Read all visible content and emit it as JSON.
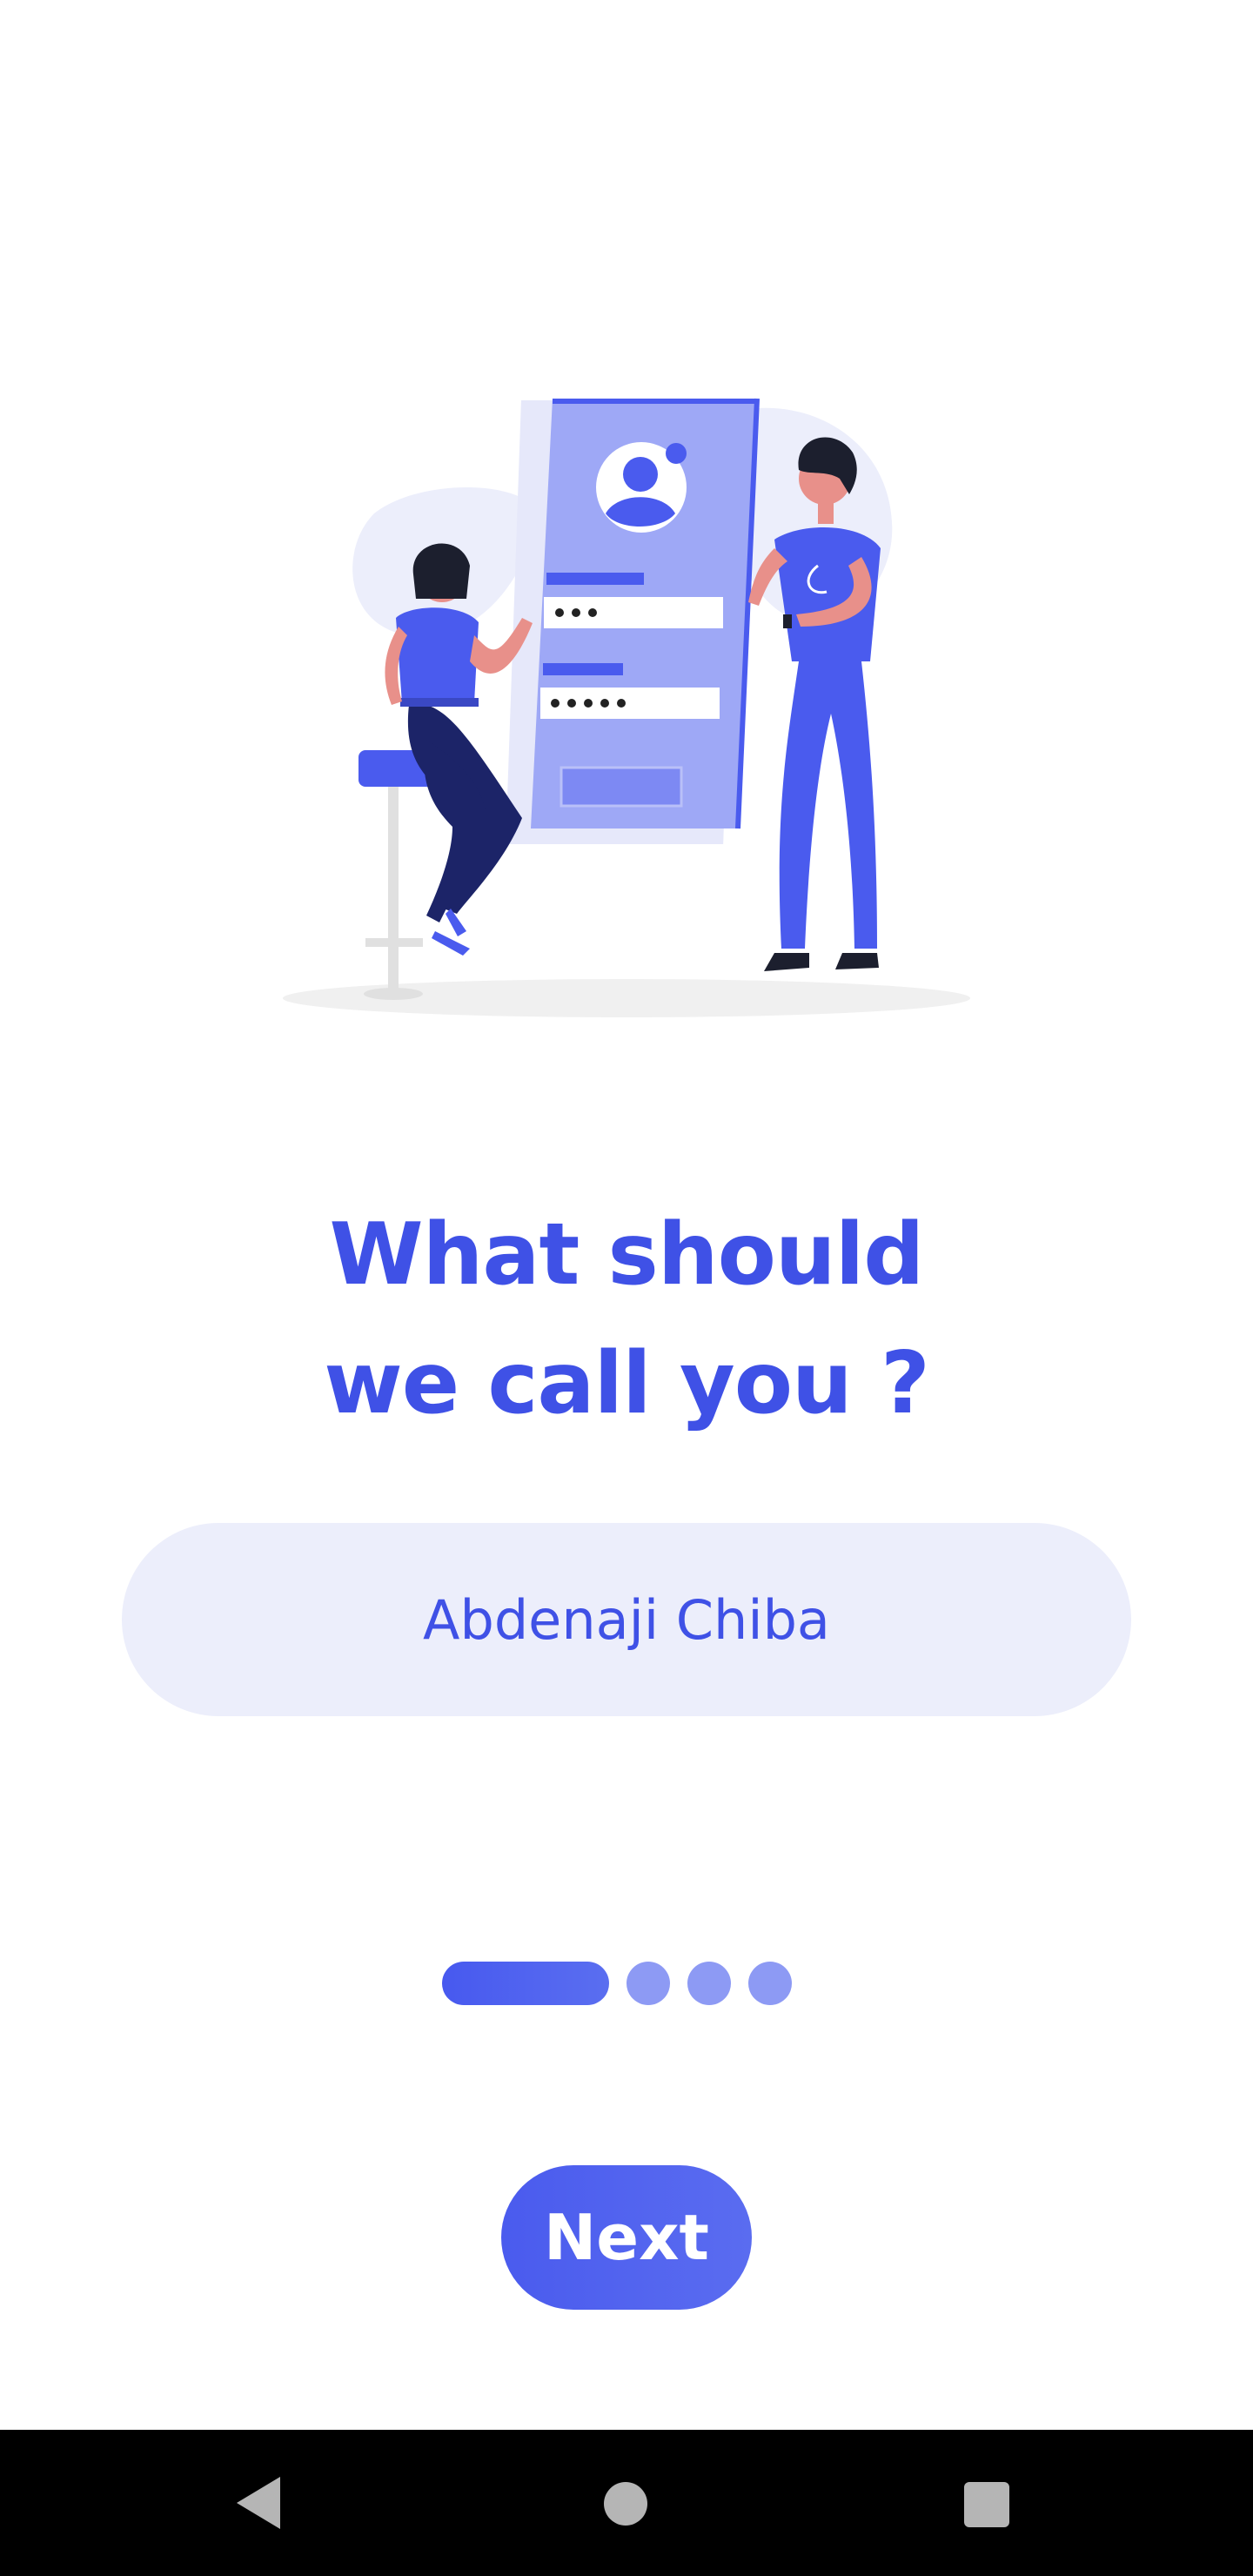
{
  "onboarding": {
    "title_line1": "What should",
    "title_line2": "we call you ?",
    "name_value": "Abdenaji Chiba",
    "next_label": "Next",
    "pager": {
      "total_steps": 4,
      "current_step": 1
    }
  },
  "navbar": {
    "back_icon": "back-triangle-icon",
    "home_icon": "home-circle-icon",
    "recents_icon": "recents-square-icon"
  },
  "colors": {
    "accent": "#3f51e6",
    "field_bg": "#eceefb",
    "dot_inactive": "#8d9af4",
    "illustration_panel": "#9ea8f6"
  }
}
